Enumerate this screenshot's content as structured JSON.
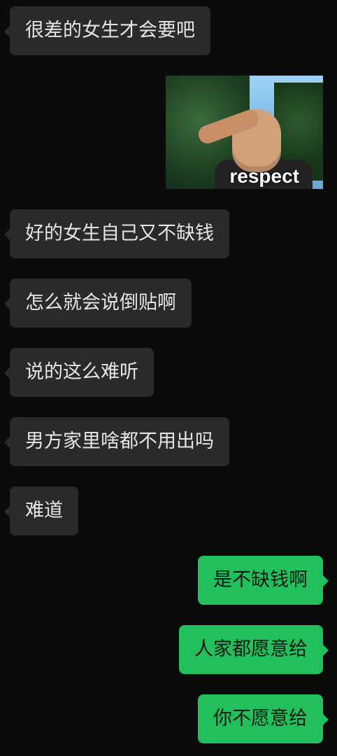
{
  "messages": [
    {
      "side": "left",
      "text": "很差的女生才会要吧"
    },
    {
      "side": "right",
      "type": "sticker",
      "caption": "respect"
    },
    {
      "side": "left",
      "text": "好的女生自己又不缺钱"
    },
    {
      "side": "left",
      "text": "怎么就会说倒贴啊"
    },
    {
      "side": "left",
      "text": "说的这么难听"
    },
    {
      "side": "left",
      "text": "男方家里啥都不用出吗"
    },
    {
      "side": "left",
      "text": "难道"
    },
    {
      "side": "right",
      "text": "是不缺钱啊"
    },
    {
      "side": "right",
      "text": "人家都愿意给"
    },
    {
      "side": "right",
      "text": "你不愿意给"
    }
  ],
  "theme": {
    "background": "#0b0b0b",
    "incoming_bubble": "#2a2a2a",
    "outgoing_bubble": "#22c05c"
  }
}
